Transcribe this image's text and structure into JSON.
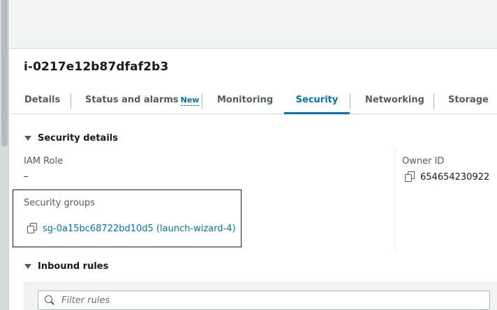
{
  "instance": {
    "id": "i-0217e12b87dfaf2b3"
  },
  "tabs": [
    {
      "label": "Details"
    },
    {
      "label": "Status and alarms",
      "badge": "New"
    },
    {
      "label": "Monitoring"
    },
    {
      "label": "Security",
      "active": true
    },
    {
      "label": "Networking"
    },
    {
      "label": "Storage"
    }
  ],
  "security_details": {
    "header": "Security details",
    "iam_role_label": "IAM Role",
    "iam_role_value": "–",
    "owner_id_label": "Owner ID",
    "owner_id_value": "654654230922",
    "security_groups_label": "Security groups",
    "security_group_link": "sg-0a15bc68722bd10d5 (launch-wizard-4)"
  },
  "inbound_rules": {
    "header": "Inbound rules",
    "filter_placeholder": "Filter rules"
  },
  "colors": {
    "link": "#0073bb",
    "text": "#16191f",
    "muted": "#545b64"
  },
  "icons": [
    "caret-down-icon",
    "copy-icon",
    "search-icon"
  ]
}
